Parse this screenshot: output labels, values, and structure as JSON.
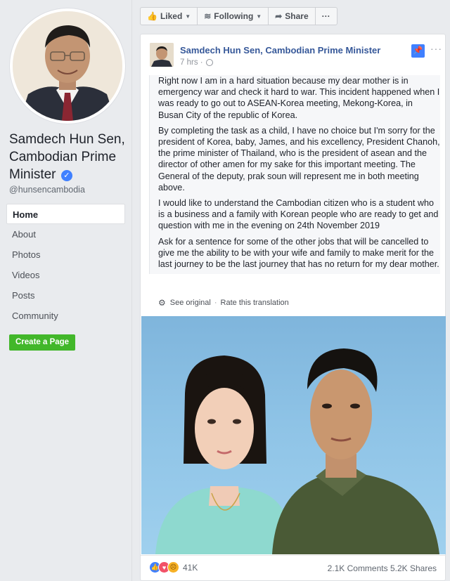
{
  "page": {
    "name": "Samdech Hun Sen, Cambodian Prime Minister",
    "handle": "@hunsencambodia",
    "verified_icon": "verified-check-icon"
  },
  "nav": {
    "items": [
      {
        "label": "Home",
        "active": true
      },
      {
        "label": "About"
      },
      {
        "label": "Photos"
      },
      {
        "label": "Videos"
      },
      {
        "label": "Posts"
      },
      {
        "label": "Community"
      }
    ],
    "create_page_label": "Create a Page"
  },
  "actionbar": {
    "liked_label": "Liked",
    "following_label": "Following",
    "share_label": "Share",
    "more_label": "···"
  },
  "post": {
    "author": "Samdech Hun Sen, Cambodian Prime Minister",
    "time": "7 hrs ·",
    "paragraphs": [
      "Right now I am in a hard situation because my dear mother is in emergency war and check it hard to war. This incident happened when I was ready to go out to ASEAN-Korea meeting, Mekong-Korea, in Busan City of the republic of Korea.",
      "By completing the task as a child, I have no choice but I'm sorry for the president of Korea, baby, James, and his excellency, President Chanoh, the prime minister of Thailand, who is the president of asean and the director of other amen for my sake for this important meeting. The General of the deputy, prak soun will represent me in both meeting above.",
      "I would like to understand the Cambodian citizen who is a student who is a business and a family with Korean people who are ready to get and question with me in the evening on 24th November 2019",
      "Ask for a sentence for some of the other jobs that will be cancelled to give me the ability to be with your wife and family to make merit for the last journey to be the last journey that has no return for my dear mother."
    ],
    "see_original": "See original",
    "rate_translation": "Rate this translation",
    "reaction_count": "41K",
    "stats_text": "2.1K Comments 5.2K Shares"
  },
  "colors": {
    "link_blue": "#365899",
    "fb_blue": "#4080ff",
    "create_green": "#42b72a",
    "background": "#e9ebee"
  }
}
